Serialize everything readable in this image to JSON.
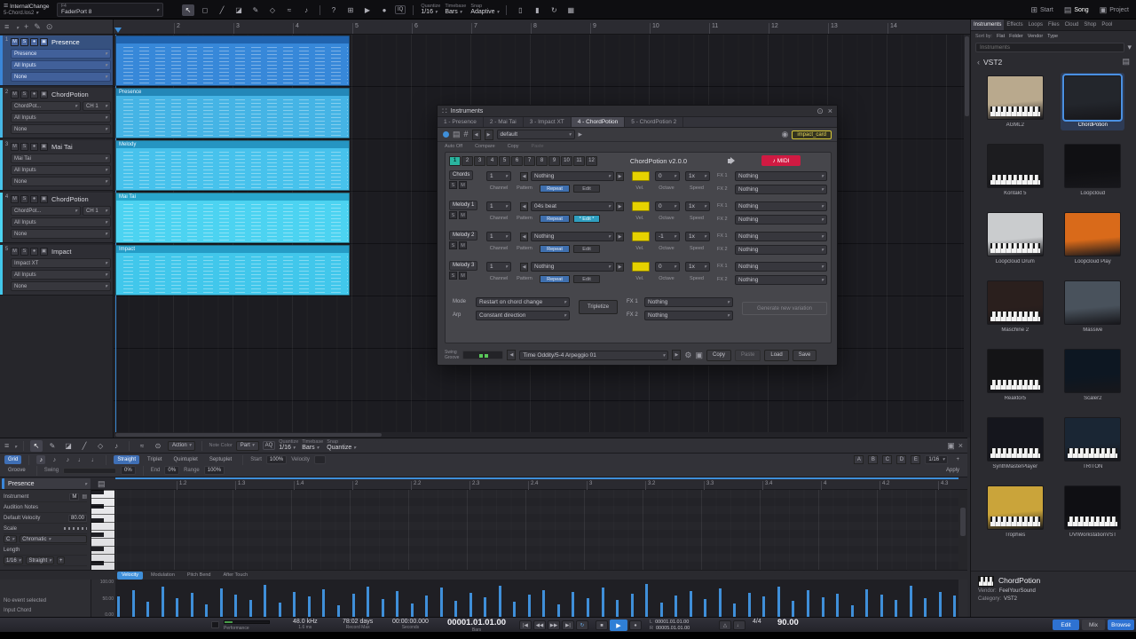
{
  "icons": {
    "menu": "≡",
    "close": "×",
    "pin": "⊙",
    "gear": "⚙",
    "copy_page": "▣",
    "prev": "◀",
    "next": "▶",
    "play": "▶",
    "stop": "■",
    "record": "●",
    "loop": "↻",
    "to_start": "|◀",
    "rewind": "◀◀",
    "forward": "▶▶",
    "to_end": "▶|",
    "note": "♪",
    "drag_dots": "∷",
    "help": "?",
    "metronome": "△",
    "quarter_note": "♩",
    "back": "‹",
    "plus": "+",
    "folder": "▤"
  },
  "titlebar": {
    "doc_title": "InternalChange",
    "doc_subtitle": "5-Chord.los2",
    "device_name": "F4",
    "device_subtitle": "FaderPort 8",
    "iq_label": "IQ",
    "quantize_label": "Quantize",
    "quantize_value": "1/16",
    "timebase_label": "Timebase",
    "timebase_value": "Bars",
    "snap_label": "Snap",
    "snap_value": "Adaptive",
    "pages": [
      "Start",
      "Song",
      "Project"
    ]
  },
  "tracks_ui": {
    "mute": "M",
    "solo": "S"
  },
  "tracks": [
    {
      "num": "1",
      "name": "Presence",
      "inst": "Presence",
      "input": "All Inputs",
      "output": "None",
      "color": "#3a86d8"
    },
    {
      "num": "2",
      "name": "ChordPotion",
      "inst": "ChordPot...",
      "ch": "CH 1",
      "input": "All Inputs",
      "output": "None",
      "color": "#46b6e6"
    },
    {
      "num": "3",
      "name": "Mai Tai",
      "inst": "Mai Tai",
      "input": "All Inputs",
      "output": "None",
      "color": "#48c4ec"
    },
    {
      "num": "4",
      "name": "ChordPotion",
      "inst": "ChordPot...",
      "ch": "CH 1",
      "input": "All Inputs",
      "output": "None",
      "color": "#4cd4f2"
    },
    {
      "num": "5",
      "name": "Impact",
      "inst": "Impact XT",
      "input": "All Inputs",
      "output": "None",
      "color": "#42c8ec"
    }
  ],
  "arrangement": {
    "ruler_ticks": [
      "2",
      "3",
      "4",
      "5",
      "6",
      "7",
      "8",
      "9",
      "10",
      "11",
      "12",
      "13",
      "14"
    ],
    "clips": [
      {
        "name": "",
        "body": "#3788d9",
        "bar": "#2063ae"
      },
      {
        "name": "Presence",
        "body": "#45b4e5",
        "bar": "#2387b8"
      },
      {
        "name": "Melody",
        "body": "#47c2ec",
        "bar": "#2595c2"
      },
      {
        "name": "Mai Tai",
        "body": "#4cd3f1",
        "bar": "#28a6cc"
      },
      {
        "name": "Impact",
        "body": "#41c7eb",
        "bar": "#259cc6"
      }
    ]
  },
  "plugin": {
    "window_title": "Instruments",
    "tabs": [
      {
        "label": "1 - Presence"
      },
      {
        "label": "2 - Mai Tai"
      },
      {
        "label": "3 - Impact XT"
      },
      {
        "label": "4 - ChordPotion"
      },
      {
        "label": "5 - ChordPotion 2"
      }
    ],
    "preset_value": "default",
    "auto_label": "Auto Off",
    "compare_label": "Compare",
    "copy_label": "Copy",
    "paste_label": "Paste",
    "event_chip": "impact_card",
    "slots": [
      "1",
      "2",
      "3",
      "4",
      "5",
      "6",
      "7",
      "8",
      "9",
      "10",
      "11",
      "12"
    ],
    "title": "ChordPotion v2.0.0",
    "midi_button": "MIDI",
    "col": {
      "channel": "Channel",
      "pattern": "Pattern",
      "vel": "Vel.",
      "octave": "Octave",
      "speed": "Speed",
      "fx1": "FX 1",
      "fx2": "FX 2",
      "repeat": "Repeat",
      "s": "S",
      "m": "M"
    },
    "rows": [
      {
        "label": "Chords",
        "channel": "1",
        "pattern": "Nothing",
        "edit": "Edit",
        "octave": "0",
        "speed": "1x",
        "fx1": "Nothing",
        "fx2": "Nothing"
      },
      {
        "label": "Melody 1",
        "channel": "1",
        "pattern": "04s beat",
        "edit": "* Edit *",
        "octave": "0",
        "speed": "1x",
        "fx1": "Nothing",
        "fx2": "Nothing"
      },
      {
        "label": "Melody 2",
        "channel": "1",
        "pattern": "Nothing",
        "edit": "Edit",
        "octave": "-1",
        "speed": "1x",
        "fx1": "Nothing",
        "fx2": "Nothing"
      },
      {
        "label": "Melody 3",
        "channel": "1",
        "pattern": "Nothing",
        "edit": "Edit",
        "octave": "0",
        "speed": "1x",
        "fx1": "Nothing",
        "fx2": "Nothing"
      }
    ],
    "mode_label": "Mode",
    "mode_value": "Restart on chord change",
    "arp_label": "Arp",
    "arp_value": "Constant direction",
    "tripletize_label": "Tripletize",
    "fx1_label": "FX 1",
    "fx1_value": "Nothing",
    "fx2_label": "FX 2",
    "fx2_value": "Nothing",
    "generate_label": "Generate new variation",
    "footer": {
      "swing_label": "Swing",
      "groove_label": "Groove",
      "preset": "Time Oddity/5-4 Arpeggio 01",
      "copy": "Copy",
      "paste": "Paste",
      "load": "Load",
      "save": "Save"
    }
  },
  "browser": {
    "tabs": [
      "Instruments",
      "Effects",
      "Loops",
      "Files",
      "Cloud",
      "Shop",
      "Pool"
    ],
    "sort_label": "Sort by:",
    "sort_options": [
      "Flat",
      "Folder",
      "Vendor",
      "Type"
    ],
    "search_placeholder": "Instruments",
    "folder": "VST2",
    "items": [
      {
        "name": "AGML2",
        "thumb": "#b9a98d",
        "keys": true
      },
      {
        "name": "ChordPotion",
        "thumb": "#23262c",
        "keys": false,
        "selected": true
      },
      {
        "name": "Kontakt 5",
        "thumb": "#1c1c1f",
        "keys": true
      },
      {
        "name": "Loopcloud",
        "thumb": "#101013",
        "keys": false
      },
      {
        "name": "Loopcloud Drum",
        "thumb": "#caccce",
        "keys": true
      },
      {
        "name": "Loopcloud Play",
        "thumb": "#d96a1a",
        "keys": false
      },
      {
        "name": "Maschine 2",
        "thumb": "#2a1f1d",
        "keys": true
      },
      {
        "name": "Massive",
        "thumb": "#49525c",
        "keys": false
      },
      {
        "name": "Reaktor5",
        "thumb": "#141416",
        "keys": true
      },
      {
        "name": "Scaler2",
        "thumb": "#0d1722",
        "keys": false
      },
      {
        "name": "SynthMasterPlayer",
        "thumb": "#15161d",
        "keys": true
      },
      {
        "name": "TRITON",
        "thumb": "#1a2634",
        "keys": true
      },
      {
        "name": "Trophies",
        "thumb": "#caa43a",
        "keys": true
      },
      {
        "name": "UVIWorkstationVST",
        "thumb": "#0f0f13",
        "keys": true
      }
    ],
    "info": {
      "name": "ChordPotion",
      "vendor_label": "Vendor:",
      "vendor": "FeelYourSound",
      "category_label": "Category:",
      "category": "VST2"
    }
  },
  "editor": {
    "toolbar": {
      "action_label": "Action",
      "note_color_label": "Note Color",
      "note_color_value": "Part",
      "aq_label": "AQ",
      "quantize_label": "Quantize",
      "quantize_value": "1/16",
      "timebase_label": "Timebase",
      "timebase_value": "Bars",
      "snap_label": "Snap",
      "snap_value": "Quantize"
    },
    "qpanel": {
      "grid": "Grid",
      "groove": "Groove",
      "modes": [
        "Straight",
        "Triplet",
        "Quintuplet",
        "Septuplet"
      ],
      "start_label": "Start",
      "start_value": "100%",
      "velocity_label": "Velocity",
      "swing_label": "Swing",
      "swing_value": "0%",
      "end_label": "End",
      "end_value": "0%",
      "range_label": "Range",
      "range_value": "100%",
      "presets": [
        "A",
        "B",
        "C",
        "D",
        "E"
      ],
      "value": "1/16",
      "apply": "Apply"
    },
    "track_selector": "Presence",
    "ruler_ticks": [
      "1.2",
      "1.3",
      "1.4",
      "2",
      "2.2",
      "2.3",
      "2.4",
      "3",
      "3.2",
      "3.3",
      "3.4",
      "4",
      "4.2",
      "4.3"
    ],
    "sidebar": {
      "instrument_label": "Instrument",
      "audition_label": "Audition Notes",
      "default_velocity_label": "Default Velocity",
      "default_velocity": "80.00",
      "scale_label": "Scale",
      "root": "C",
      "scale": "Chromatic",
      "length_label": "Length",
      "length_value": "1/16",
      "length_mode": "Straight",
      "no_event": "No event selected",
      "input_chord": "Input Chord"
    },
    "lane_tabs": [
      "Velocity",
      "Modulation",
      "Pitch Bend",
      "After Touch"
    ],
    "lane_scale": [
      "100.00",
      "50.00",
      "0.00"
    ],
    "velocity_bars": [
      24,
      31,
      18,
      35,
      22,
      28,
      15,
      33,
      26,
      20,
      37,
      17,
      29,
      24,
      32,
      14,
      27,
      35,
      21,
      30,
      16,
      25,
      34,
      19,
      28,
      23,
      36,
      18,
      26,
      31,
      15,
      29,
      22,
      34,
      20,
      27,
      38,
      17,
      25,
      30,
      21,
      33,
      16,
      28,
      24,
      35,
      19,
      31,
      23,
      27,
      14,
      32,
      26,
      20,
      36,
      22,
      29,
      25
    ]
  },
  "transport": {
    "performance_label": "Performance",
    "sample_rate": "48.0 kHz",
    "latency": "1.6 ms",
    "record_time": "78:02 days",
    "record_time_label": "Record Max",
    "time": "00:00:00.000",
    "time_label": "Seconds",
    "position": "00001.01.01.00",
    "position_label": "Bars",
    "loop_start_label": "L",
    "loop_start": "00001.01.01.00",
    "loop_end_label": "R",
    "loop_end": "00005.01.01.00",
    "time_sig": "4/4",
    "tempo": "90.00",
    "edit": "Edit",
    "mix": "Mix",
    "browse": "Browse"
  }
}
